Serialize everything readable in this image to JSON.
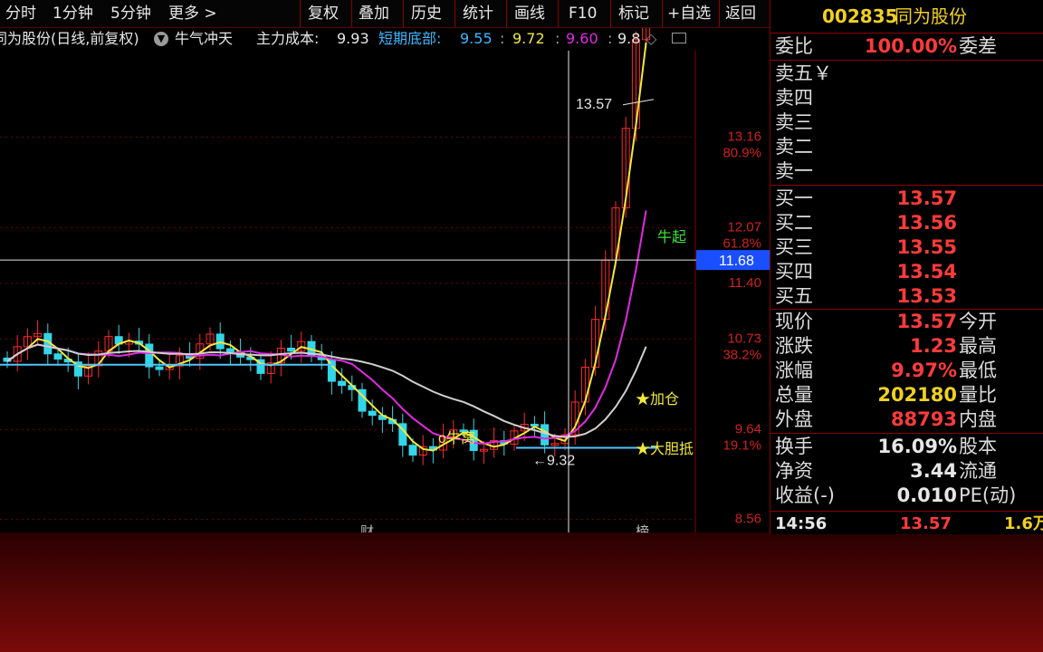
{
  "toolbar": {
    "left_tabs": [
      "分时",
      "1分钟",
      "5分钟",
      "更多 >"
    ],
    "buttons": [
      "复权",
      "叠加",
      "历史",
      "统计",
      "画线",
      "F10",
      "标记",
      "+自选",
      "返回"
    ]
  },
  "infobar": {
    "name_mode": "同为股份(日线,前复权)",
    "indicator": "牛气冲天",
    "main_cost_label": "主力成本:",
    "main_cost_value": "9.93",
    "short_bottom_label": "短期底部:",
    "v1": "9.55",
    "v2": "9.72",
    "v3": "9.60",
    "v4": "9.8"
  },
  "chart_data": {
    "type": "candlestick",
    "price_axis_labels": [
      {
        "price": "13.16",
        "pct": "80.9%"
      },
      {
        "price": "12.07",
        "pct": "61.8%"
      },
      {
        "price": "11.40",
        "pct": ""
      },
      {
        "price": "10.73",
        "pct": "38.2%"
      },
      {
        "price": "9.64",
        "pct": "19.1%"
      },
      {
        "price": "8.56",
        "pct": ""
      }
    ],
    "crosshair_price": "11.68",
    "high_marker": "13.57",
    "low_marker": "9.32",
    "annotations": [
      "牛起",
      "加仓",
      "o牛窝",
      "★大胆抵"
    ],
    "bottom_marks": [
      "财",
      "榜"
    ],
    "colors": {
      "up": "#ff2a2a",
      "down": "#33d6e8",
      "ma_yellow": "#f2e93c",
      "ma_magenta": "#e12be1",
      "ma_white": "#cfcfcf",
      "support": "#4fc6ff"
    }
  },
  "panel": {
    "code": "002835",
    "name": "同为股份",
    "ratio_label": "委比",
    "ratio_value": "100.00%",
    "diff_label": "委差",
    "sells": [
      "卖五￥",
      "卖四",
      "卖三",
      "卖二",
      "卖一"
    ],
    "buys": [
      {
        "label": "买一",
        "price": "13.57"
      },
      {
        "label": "买二",
        "price": "13.56"
      },
      {
        "label": "买三",
        "price": "13.55"
      },
      {
        "label": "买四",
        "price": "13.54"
      },
      {
        "label": "买五",
        "price": "13.53"
      }
    ],
    "stats": [
      {
        "label": "现价",
        "value": "13.57",
        "label2": "今开",
        "color": "#ff3b3b"
      },
      {
        "label": "涨跌",
        "value": "1.23",
        "label2": "最高",
        "color": "#ff3b3b"
      },
      {
        "label": "涨幅",
        "value": "9.97%",
        "label2": "最低",
        "color": "#ff3b3b"
      },
      {
        "label": "总量",
        "value": "202180",
        "label2": "量比",
        "color": "#f0d020"
      },
      {
        "label": "外盘",
        "value": "88793",
        "label2": "内盘",
        "color": "#ff3b3b"
      }
    ],
    "stats2": [
      {
        "label": "换手",
        "value": "16.09%",
        "label2": "股本"
      },
      {
        "label": "净资",
        "value": "3.44",
        "label2": "流通"
      },
      {
        "label": "收益(-)",
        "value": "0.010",
        "label2": "PE(动)"
      }
    ],
    "tick": {
      "time": "14:56",
      "price": "13.57",
      "vol": "1.6万"
    }
  }
}
